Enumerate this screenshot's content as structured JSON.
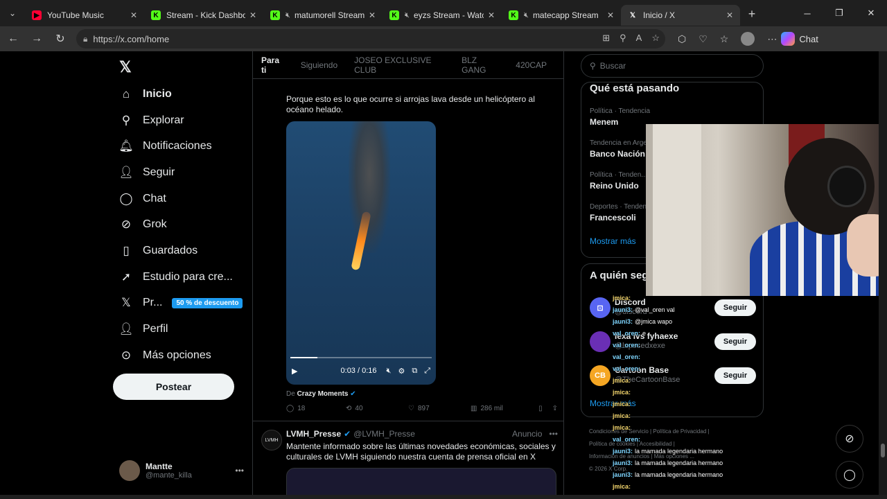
{
  "browser": {
    "tabs": [
      {
        "title": "YouTube Music",
        "icon": "youtube-music-icon",
        "color": "#ff0033",
        "muted": false
      },
      {
        "title": "Stream - Kick Dashboard",
        "icon": "kick-icon",
        "color": "#53fc18",
        "muted": false
      },
      {
        "title": "matumorell Stream",
        "icon": "kick-icon",
        "color": "#53fc18",
        "muted": true
      },
      {
        "title": "eyzs Stream - Watch",
        "icon": "kick-icon",
        "color": "#53fc18",
        "muted": true
      },
      {
        "title": "matecapp Stream",
        "icon": "kick-icon",
        "color": "#53fc18",
        "muted": true
      },
      {
        "title": "Inicio / X",
        "icon": "x-icon",
        "color": "#ffffff",
        "muted": false
      }
    ],
    "url": "https://x.com/home",
    "chat_label": "Chat"
  },
  "nav": {
    "items": [
      {
        "label": "Inicio",
        "icon": "home-icon",
        "glyph": "⌂"
      },
      {
        "label": "Explorar",
        "icon": "search-icon",
        "glyph": "⚲"
      },
      {
        "label": "Notificaciones",
        "icon": "bell-icon",
        "glyph": "🔔︎"
      },
      {
        "label": "Seguir",
        "icon": "add-person-icon",
        "glyph": "👤︎"
      },
      {
        "label": "Chat",
        "icon": "chat-icon",
        "glyph": "◯"
      },
      {
        "label": "Grok",
        "icon": "grok-icon",
        "glyph": "⊘"
      },
      {
        "label": "Guardados",
        "icon": "bookmark-icon",
        "glyph": "▯"
      },
      {
        "label": "Estudio para cre...",
        "icon": "rocket-icon",
        "glyph": "➚"
      },
      {
        "label": "Pr...",
        "icon": "x-premium-icon",
        "glyph": "𝕏"
      },
      {
        "label": "Perfil",
        "icon": "person-icon",
        "glyph": "👤︎"
      },
      {
        "label": "Más opciones",
        "icon": "more-circle-icon",
        "glyph": "⊙"
      }
    ],
    "premium_badge": "50 % de descuento",
    "post_button": "Postear",
    "profile": {
      "name": "Mantte",
      "handle": "@mante_killa"
    }
  },
  "feed": {
    "tabs": [
      "Para ti",
      "Siguiendo",
      "JOSEO EXCLUSIVE CLUB",
      "BLZ GANG",
      "420CAP"
    ],
    "post": {
      "text": "Porque esto es lo que ocurre si arrojas lava desde un helicóptero al océano helado.",
      "video_time": "0:03 / 0:16",
      "video_progress": 0.19,
      "from_prefix": "De",
      "from_account": "Crazy Moments",
      "stats": {
        "replies": "18",
        "reposts": "40",
        "likes": "897",
        "views": "286 mil"
      }
    },
    "ad": {
      "name": "LVMH_Presse",
      "handle": "@LVMH_Presse",
      "label": "Anuncio",
      "avatar_text": "LVMH",
      "text": "Mantente informado sobre las últimas novedades económicas, sociales y culturales de LVMH siguiendo nuestra cuenta de prensa oficial en X"
    }
  },
  "sidebar": {
    "search_placeholder": "Buscar",
    "trends_title": "Qué está pasando",
    "trends": [
      {
        "meta": "Política · Tendencia",
        "name": "Menem"
      },
      {
        "meta": "Tendencia en Arge...",
        "name": "Banco Nación"
      },
      {
        "meta": "Política · Tenden...",
        "name": "Reino Unido"
      },
      {
        "meta": "Deportes · Tenden...",
        "name": "Francescoli"
      }
    ],
    "show_more": "Mostrar más",
    "follow_title": "A quién seg...",
    "suggestions": [
      {
        "name": "Discord",
        "handle": "@discord",
        "avatar": "⊡",
        "color": "#5865f2",
        "button": "Seguir"
      },
      {
        "name": "lexa ivs fyhaexe",
        "handle": "@lupesedxexe",
        "avatar": "",
        "color": "#6a2fb5",
        "button": "Seguir"
      },
      {
        "name": "Cartoon Base",
        "handle": "@TheCartoonBase",
        "avatar": "CB",
        "color": "#f5a623",
        "button": "Seguir"
      }
    ],
    "footer": [
      "Condiciones de Servicio | Política de Privacidad |",
      "Política de cookies | Accesibilidad |",
      "Información de anuncios | Más opciones ...",
      "© 2026 X Corp."
    ]
  },
  "stream_chat": [
    {
      "user": "jmica:",
      "msg": "",
      "cls": "u"
    },
    {
      "user": "jauni3:",
      "msg": "@val_oren val",
      "cls": "u2"
    },
    {
      "user": "jauni3:",
      "msg": "@jmica wapo",
      "cls": "u2"
    },
    {
      "user": "val_oren:",
      "msg": "e",
      "cls": "u2"
    },
    {
      "user": "val_oren:",
      "msg": "",
      "cls": "u2"
    },
    {
      "user": "val_oren:",
      "msg": "",
      "cls": "u2"
    },
    {
      "user": "val_oren:",
      "msg": "",
      "cls": "u2"
    },
    {
      "user": "jmica:",
      "msg": "",
      "cls": "u"
    },
    {
      "user": "jmica:",
      "msg": "",
      "cls": "u"
    },
    {
      "user": "jmica:",
      "msg": "",
      "cls": "u"
    },
    {
      "user": "jmica:",
      "msg": "",
      "cls": "u"
    },
    {
      "user": "jmica:",
      "msg": "",
      "cls": "u"
    },
    {
      "user": "val_oren:",
      "msg": "",
      "cls": "u2"
    },
    {
      "user": "jauni3:",
      "msg": "la mamada legendaria hermano",
      "cls": "u2"
    },
    {
      "user": "jauni3:",
      "msg": "la mamada legendaria hermano",
      "cls": "u2"
    },
    {
      "user": "jauni3:",
      "msg": "la mamada legendaria hermano",
      "cls": "u2"
    },
    {
      "user": "jmica:",
      "msg": "",
      "cls": "u"
    }
  ]
}
